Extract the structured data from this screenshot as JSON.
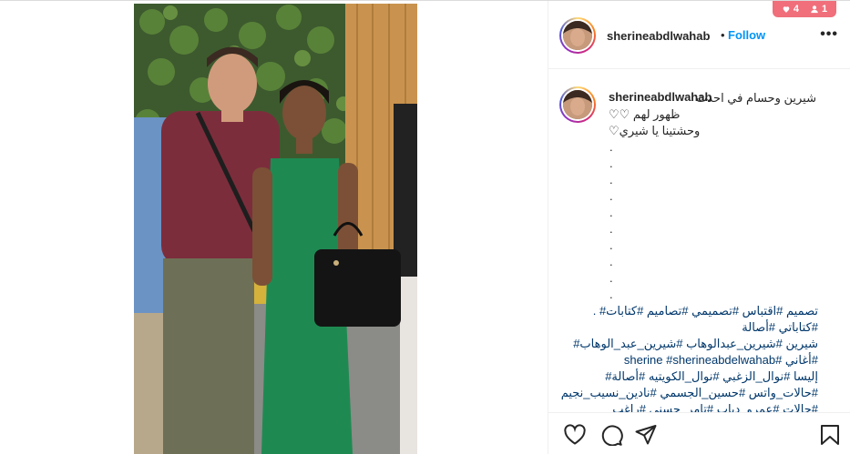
{
  "badge": {
    "likes": "4",
    "follows": "1",
    "heart_icon": "heart-icon",
    "user_icon": "user-icon"
  },
  "header": {
    "username": "sherineabdlwahab",
    "dot": "•",
    "follow": "Follow",
    "more": "•••"
  },
  "caption": {
    "username": "sherineabdlwahab",
    "line1": "شيرين وحسام في احدث",
    "line2": "ظهور لهم ♡♡",
    "line3": "وحشتينا يا شيري♡",
    "dots": [
      ".",
      ".",
      ".",
      ".",
      ".",
      ".",
      ".",
      ".",
      ".",
      "."
    ],
    "hashtags": [
      "تصميم #اقتباس #تصميمي #تصاميم #كتابات# .",
      "#كتاباتي #أصالة",
      "شيرين #شيرين_عبدالوهاب #شيرين_عبد_الوهاب#",
      "#أغاني #sherine #sherineabdelwahab",
      "إليسا #نوال_الزغبي #نوال_الكويتيه #أصالة#",
      "#حالات_واتس #حسين_الجسمي #نادين_نسيب_نجيم",
      "#حالات #عمرو_دياب #تامر_حسني #راغب"
    ]
  },
  "actions": {
    "like": "heart-outline-icon",
    "comment": "comment-icon",
    "share": "paper-plane-icon",
    "save": "bookmark-icon"
  },
  "colors": {
    "follow": "#0095f6",
    "badge": "#f06f7b",
    "text": "#262626"
  }
}
